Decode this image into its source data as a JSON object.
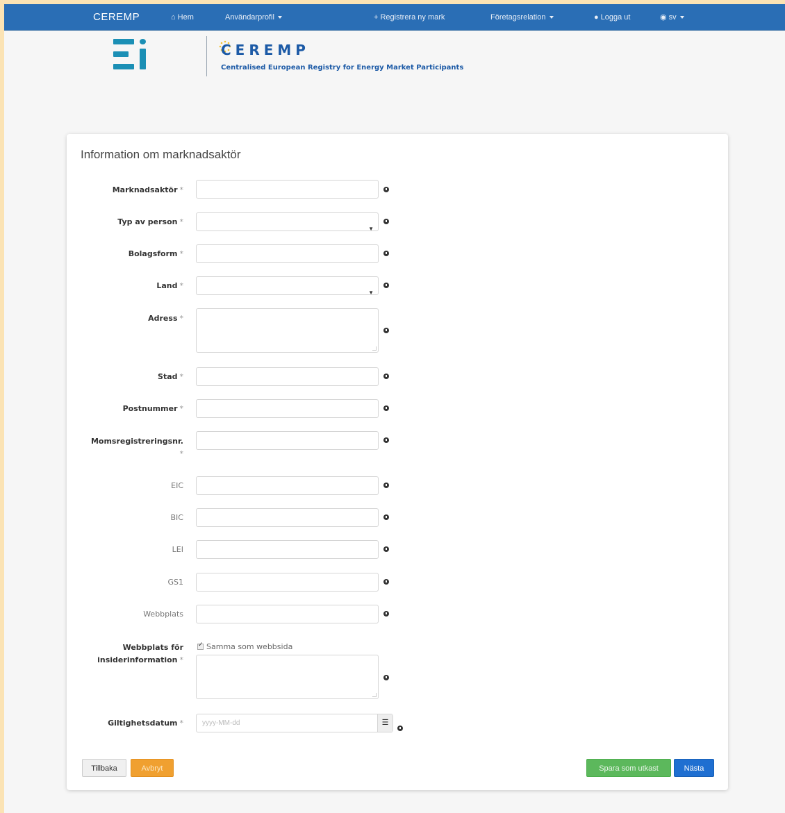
{
  "nav": {
    "brand": "CEREMP",
    "home": "Hem",
    "user_profile": "Användarprofil",
    "register": "+ Registrera ny mark",
    "company_relation": "Företagsrelation",
    "logout": "Logga ut",
    "language": "sv"
  },
  "header": {
    "ceremp_title": "CEREMP",
    "ceremp_subtitle": "Centralised European Registry for Energy Market Participants"
  },
  "panel": {
    "title": "Information om marknadsaktör"
  },
  "form": {
    "fields": [
      {
        "label": "Marknadsaktör",
        "required": true
      },
      {
        "label": "Typ av person",
        "required": true
      },
      {
        "label": "Bolagsform",
        "required": true
      },
      {
        "label": "Land",
        "required": true
      },
      {
        "label": "Adress",
        "required": true
      },
      {
        "label": "Stad",
        "required": true
      },
      {
        "label": "Postnummer",
        "required": true
      },
      {
        "label": "Momsregistreringsnr.",
        "required": true
      },
      {
        "label": "EIC",
        "required": false
      },
      {
        "label": "BIC",
        "required": false
      },
      {
        "label": "LEI",
        "required": false
      },
      {
        "label": "GS1",
        "required": false
      },
      {
        "label": "Webbplats",
        "required": false
      },
      {
        "label": "Webbplats för insiderinformation",
        "required": true
      },
      {
        "label": "Giltighetsdatum",
        "required": true
      }
    ],
    "same_as_website_label": "Samma som webbsida",
    "date_placeholder": "yyyy-MM-dd",
    "required_marker": "*"
  },
  "buttons": {
    "back": "Tillbaka",
    "cancel": "Avbryt",
    "save_draft": "Spara som utkast",
    "next": "Nästa"
  },
  "colors": {
    "navbar": "#2a6eb5",
    "accent": "#1c5aa6",
    "draft": "#5cb85c",
    "next": "#1f6fd1",
    "cancel": "#f0a030"
  }
}
